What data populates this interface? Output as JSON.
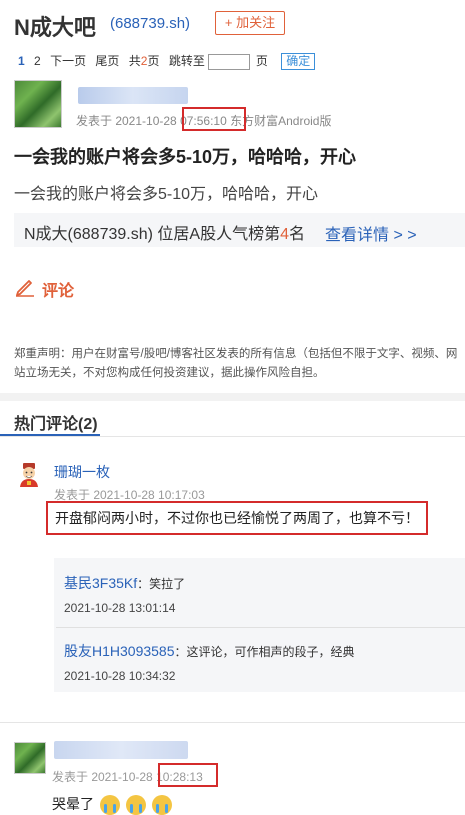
{
  "header": {
    "title": "N成大吧",
    "stock_code": "(688739.sh)",
    "follow_label": "+ 加关注"
  },
  "pager": {
    "page1": "1",
    "page2": "2",
    "next": "下一页",
    "last": "尾页",
    "total_prefix": "共",
    "total_pages": "2",
    "total_suffix": "页",
    "jump_prefix": "跳转至",
    "jump_suffix": "页",
    "confirm_label": "确定"
  },
  "post": {
    "meta_prefix": "发表于 2021-10-28 ",
    "time": "07:56:10",
    "source": " 东方财富Android版",
    "title": "一会我的账户将会多5-10万，哈哈哈，开心",
    "body": "一会我的账户将会多5-10万，哈哈哈，开心",
    "rank_prefix": "N成大(688739.sh) 位居A股人气榜第",
    "rank_number": "4",
    "rank_suffix": "名",
    "rank_link": "查看详情 > >",
    "comment_label": "评论",
    "disclaimer": "郑重声明：用户在财富号/股吧/博客社区发表的所有信息（包括但不限于文字、视频、网站立场无关，不对您构成任何投资建议，据此操作风险自担。"
  },
  "hot_comments": {
    "title": "热门评论(2)",
    "items": [
      {
        "user": "珊瑚一枚",
        "meta": "发表于 2021-10-28 10:17:03",
        "text": "开盘郁闷两小时，不过你也已经愉悦了两周了，也算不亏！",
        "replies": [
          {
            "user": "基民3F35Kf",
            "text": "：笑拉了",
            "time": "2021-10-28 13:01:14"
          },
          {
            "user": "股友H1H3093585",
            "text": "：这评论，可作相声的段子，经典",
            "time": "2021-10-28 10:34:32"
          }
        ]
      },
      {
        "meta_prefix": "发表于 2021-10-28 ",
        "time": "10:28:13",
        "text": "哭晕了"
      }
    ]
  },
  "colors": {
    "accent_blue": "#2a62b8",
    "accent_orange": "#e0613a",
    "highlight_red": "#d42b2b"
  },
  "icons": [
    "pen-icon",
    "god-of-wealth-icon",
    "crying-emoji-icon"
  ]
}
